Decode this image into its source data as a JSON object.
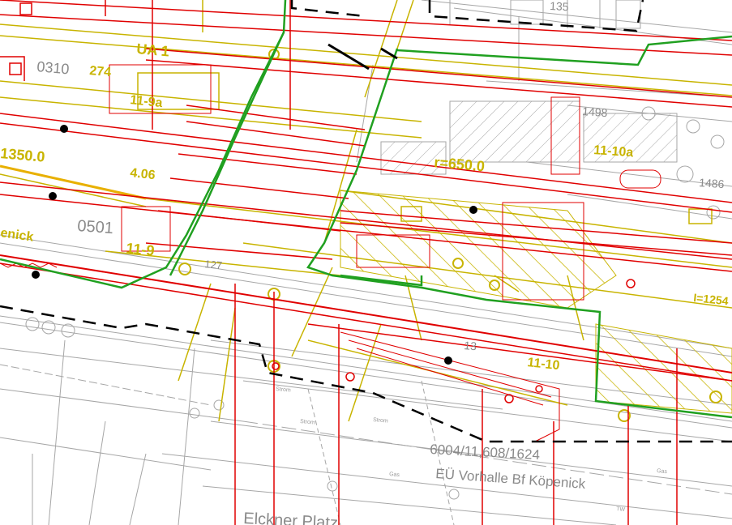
{
  "labels": {
    "ua1": "UA 1",
    "num_0310": "0310",
    "num_274": "274",
    "r11_9a": "11-9a",
    "num_350": "1350.0",
    "num_406": "4.06",
    "enick": "enick",
    "num_0501": "0501",
    "r11_9": "11-9",
    "num_127": "127",
    "radius": "r=650.0",
    "r11_10a": "11-10a",
    "num_1498": "1498",
    "num_1486": "1486",
    "num_135": "135",
    "r11_10": "11-10",
    "num_13": "13",
    "i_1254": "I=1254",
    "parcel_ref": "6004/11,608/1624",
    "bridge_name": "EÜ Vorhalle Bf Köpenick",
    "place_name": "Elckner Platz",
    "small_strom": "Strom",
    "small_gas": "Gas",
    "small_tw": "TW"
  },
  "colors": {
    "red": "#e00000",
    "green": "#20a020",
    "olive": "#c8b400",
    "grey": "#a6a6a6",
    "black": "#000000"
  }
}
